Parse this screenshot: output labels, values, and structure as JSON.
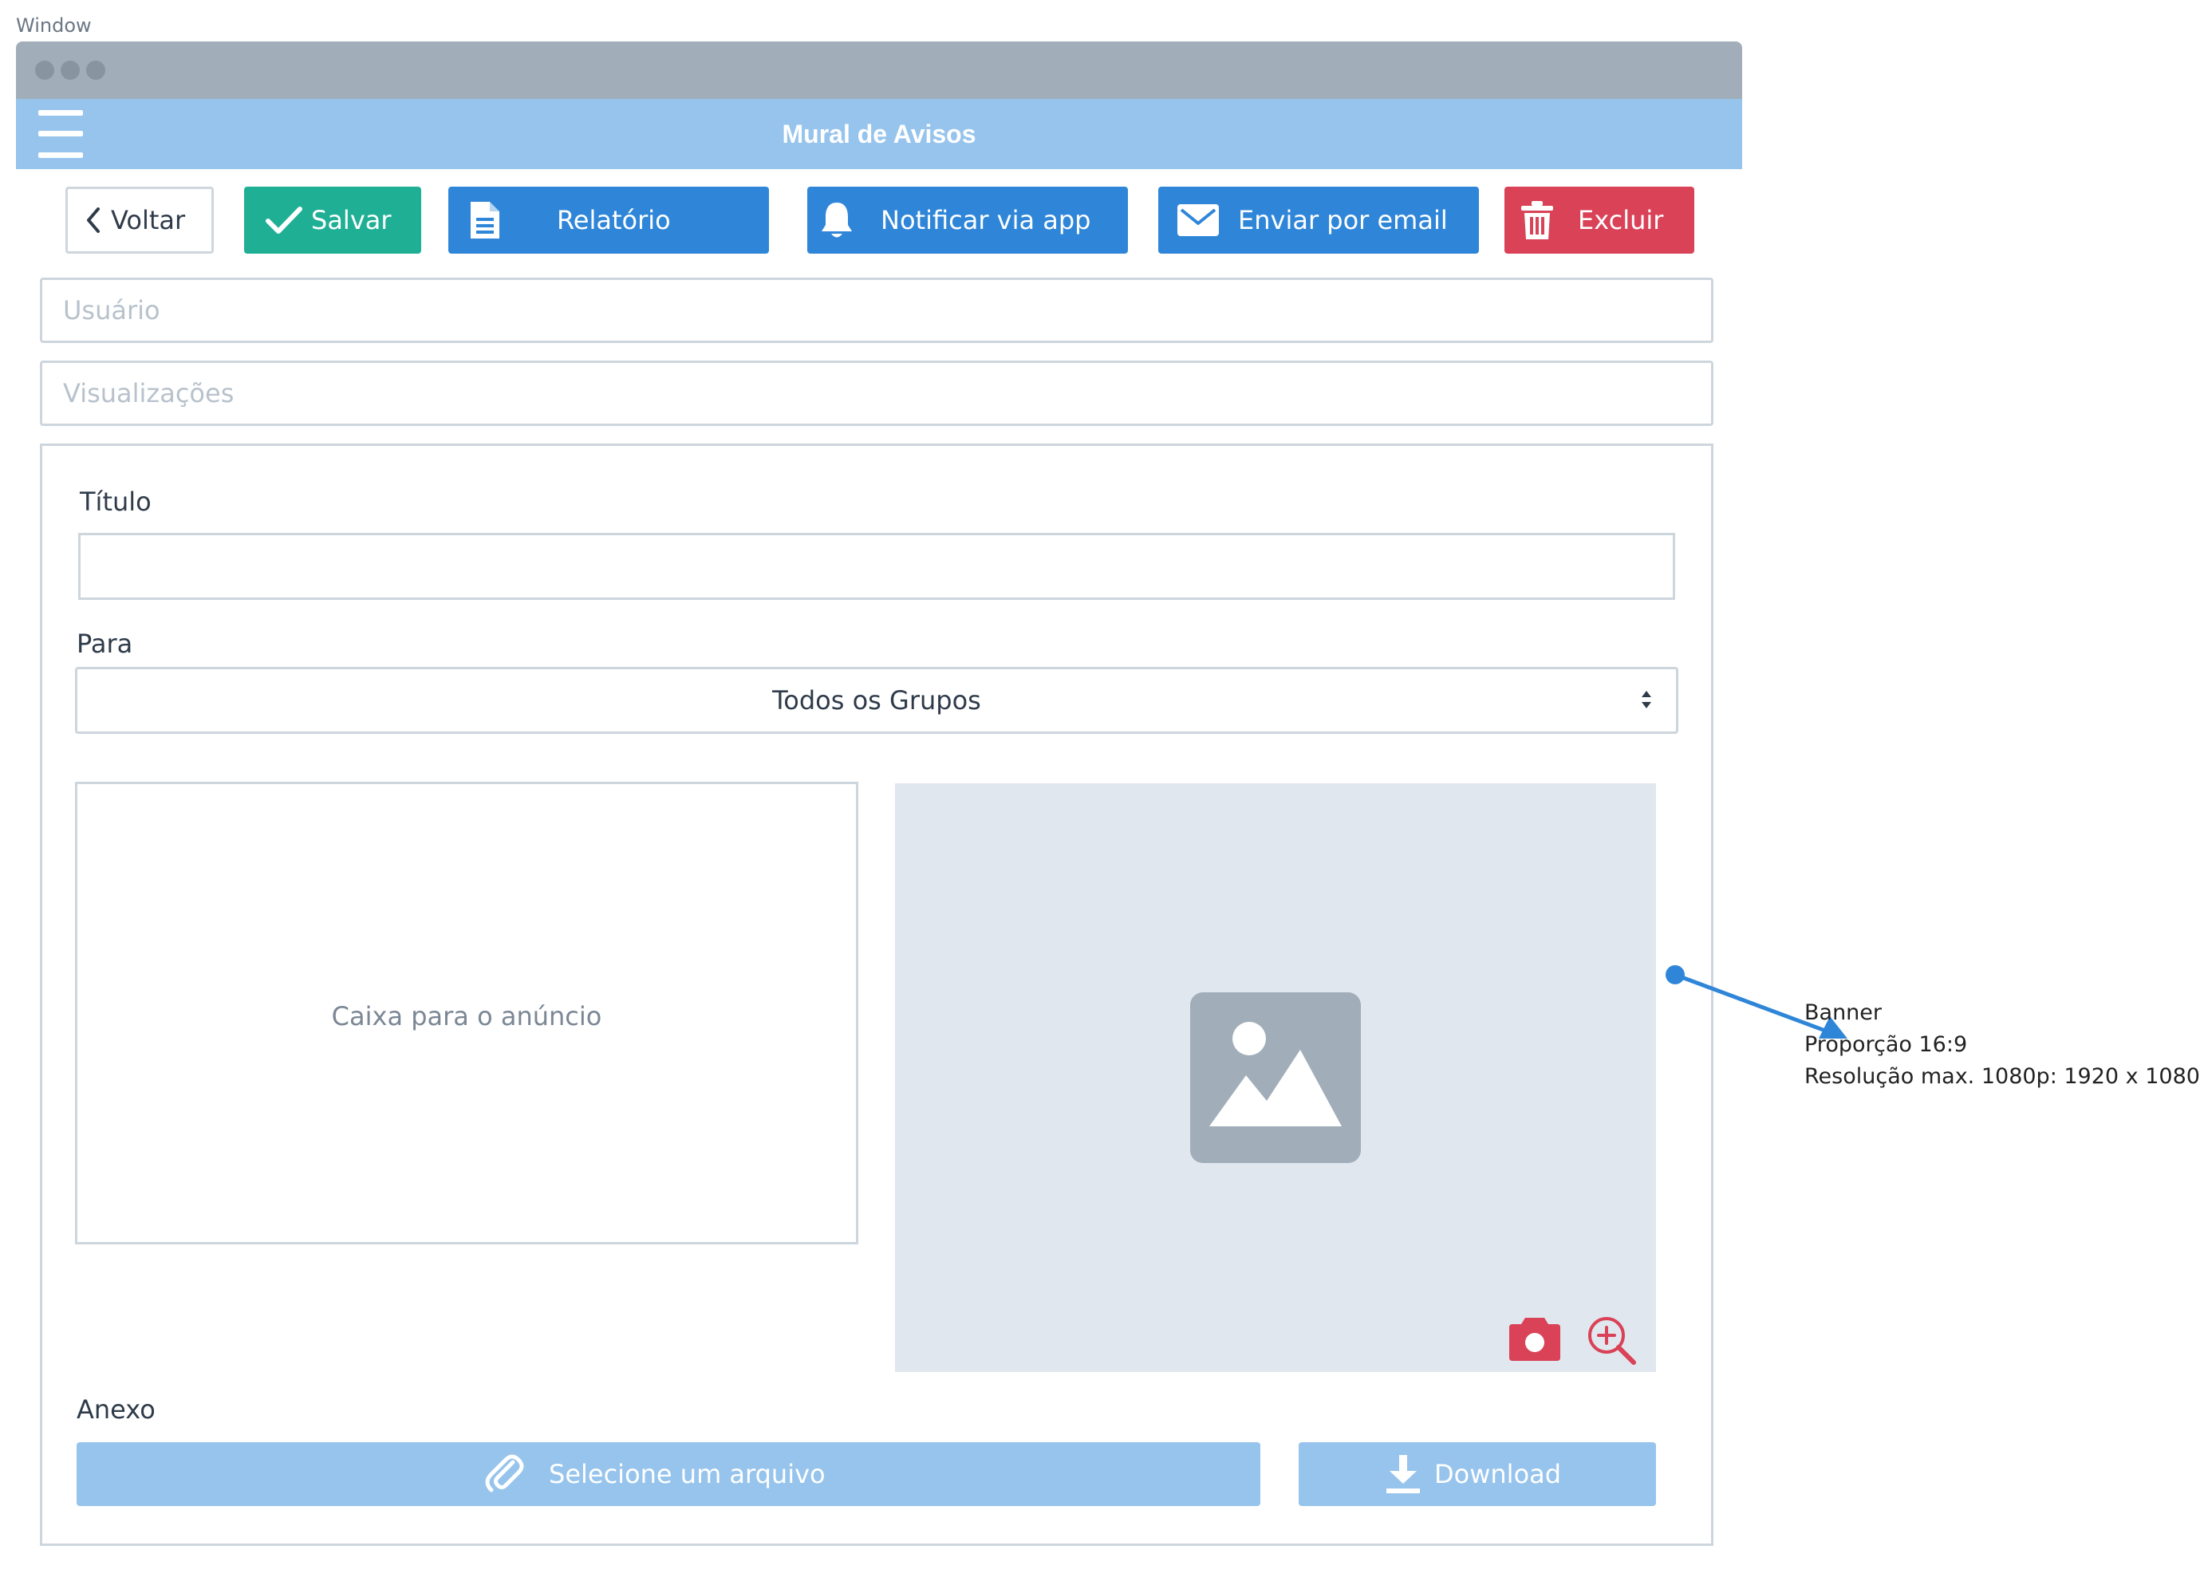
{
  "window": {
    "label": "Window"
  },
  "app": {
    "title": "Mural de Avisos"
  },
  "toolbar": {
    "back_label": "Voltar",
    "save_label": "Salvar",
    "report_label": "Relatório",
    "notify_label": "Notificar via app",
    "email_label": "Enviar por email",
    "delete_label": "Excluir"
  },
  "fields": {
    "user_placeholder": "Usuário",
    "views_placeholder": "Visualizações"
  },
  "form": {
    "title_label": "Título",
    "title_value": "",
    "to_label": "Para",
    "to_selected": "Todos os Grupos",
    "announcement_placeholder": "Caixa para o anúncio",
    "attachment_label": "Anexo",
    "select_file_label": "Selecione um arquivo",
    "download_label": "Download"
  },
  "annotation": {
    "line1": "Banner",
    "line2": "Proporção 16:9",
    "line3": "Resolução max. 1080p: 1920 x 1080"
  },
  "icons": {
    "back": "chevron-left-icon",
    "save": "check-icon",
    "report": "document-icon",
    "notify": "bell-icon",
    "email": "envelope-icon",
    "delete": "trash-icon",
    "banner": "image-placeholder-icon",
    "camera": "camera-icon",
    "zoom": "zoom-in-icon",
    "attach": "paperclip-icon",
    "download": "download-icon"
  },
  "colors": {
    "save": "#1faf95",
    "primary": "#2f86d8",
    "danger": "#d94257",
    "appbar": "#97c4ec",
    "titlebar": "#a1adb8",
    "banner_bg": "#e1e7ef",
    "annotation": "#2f86d8"
  }
}
